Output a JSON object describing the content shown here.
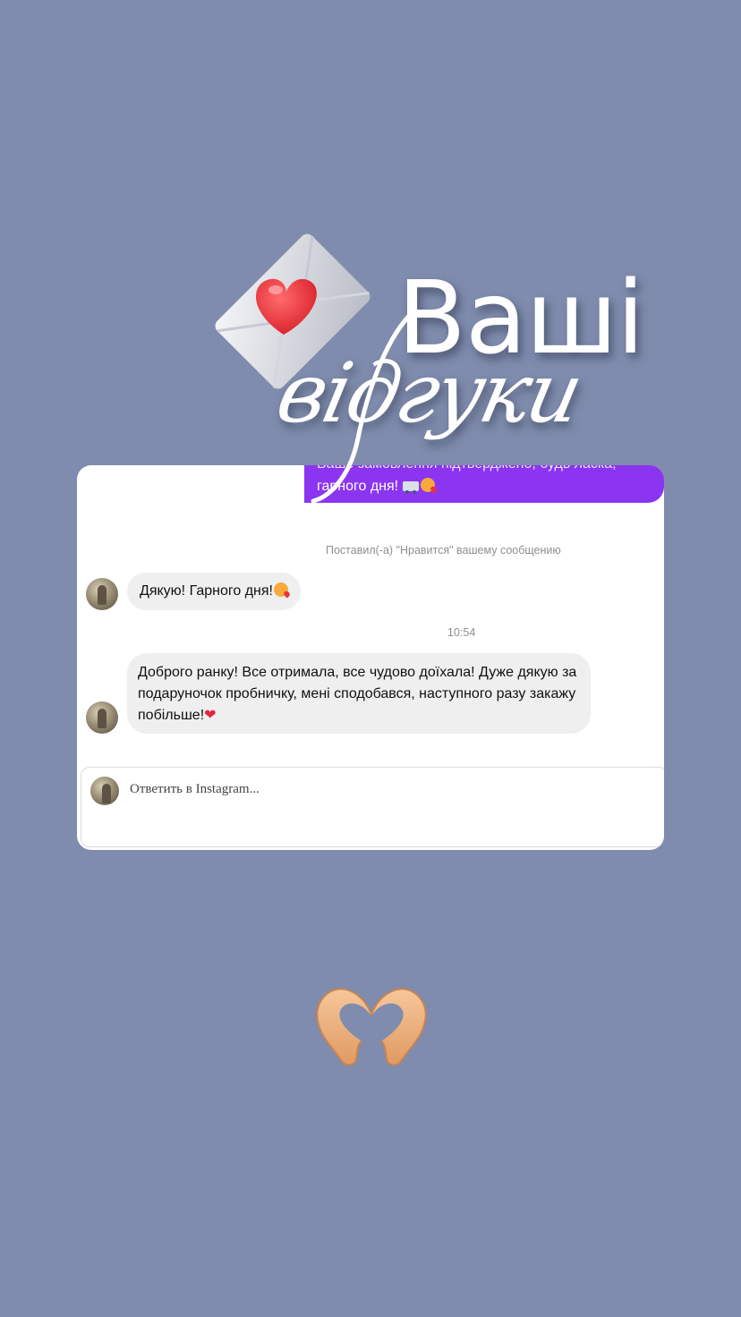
{
  "header": {
    "title_line1": "Ваші",
    "title_line2": "відгуки"
  },
  "chat": {
    "outgoing_message": {
      "line1": "Ваше замовлення підтверджено, будь ласка,",
      "line2": "гарного дня!"
    },
    "like_notice": "Поставил(-а) \"Нравится\" вашему сообщению",
    "messages": [
      {
        "text": "Дякую! Гарного дня!"
      },
      {
        "timestamp": "10:54"
      },
      {
        "text": "Доброго ранку! Все отримала, все чудово доїхала! Дуже дякую за подаруночок пробничку, мені сподобався, наступного разу закажу побільше!"
      }
    ],
    "reply": {
      "placeholder": "Ответить в Instagram..."
    }
  },
  "icons": [
    "envelope-heart-icon",
    "heart-hands-icon",
    "kiss-emoji-icon",
    "truck-emoji-icon",
    "red-heart-emoji-icon"
  ],
  "colors": {
    "background": "#7f8cad",
    "outgoing_bubble": "#8b35f0",
    "incoming_bubble": "#efefef",
    "heart": "#e8343c"
  }
}
